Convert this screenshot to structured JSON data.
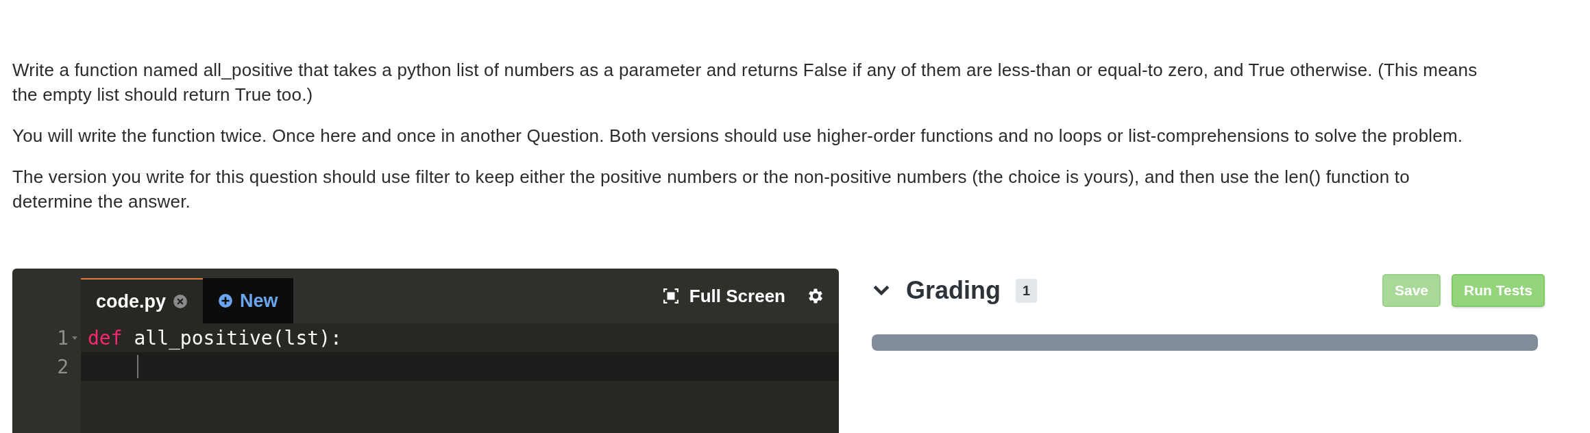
{
  "prompt": {
    "paragraphs": [
      "Write a function named all_positive that takes a python list of numbers as a parameter and returns False if any of them are less-than or equal-to zero, and True otherwise. (This means the empty list should return True too.)",
      "You will write the function twice. Once here and once in another Question. Both versions should use higher-order functions and no loops or list-comprehensions to solve the problem.",
      "The version you write for this question should use filter to keep either the positive numbers or the non-positive numbers (the choice is yours), and then use the len() function to determine the answer."
    ]
  },
  "editor": {
    "tabs": [
      {
        "label": "code.py",
        "selected": true,
        "kind": "file"
      },
      {
        "label": "New",
        "selected": false,
        "kind": "new"
      }
    ],
    "full_screen": "Full Screen",
    "lines": [
      {
        "number": "1",
        "foldable": true,
        "active": false,
        "tokens": [
          {
            "kind": "keyword",
            "text": "def"
          },
          {
            "kind": "plain",
            "text": " all_positive(lst):"
          }
        ]
      },
      {
        "number": "2",
        "foldable": false,
        "active": true
      }
    ]
  },
  "grading": {
    "expanded": true,
    "title": "Grading",
    "count": "1",
    "buttons": [
      {
        "label": "Save",
        "disabled": true
      },
      {
        "label": "Run Tests",
        "disabled": false
      }
    ]
  }
}
